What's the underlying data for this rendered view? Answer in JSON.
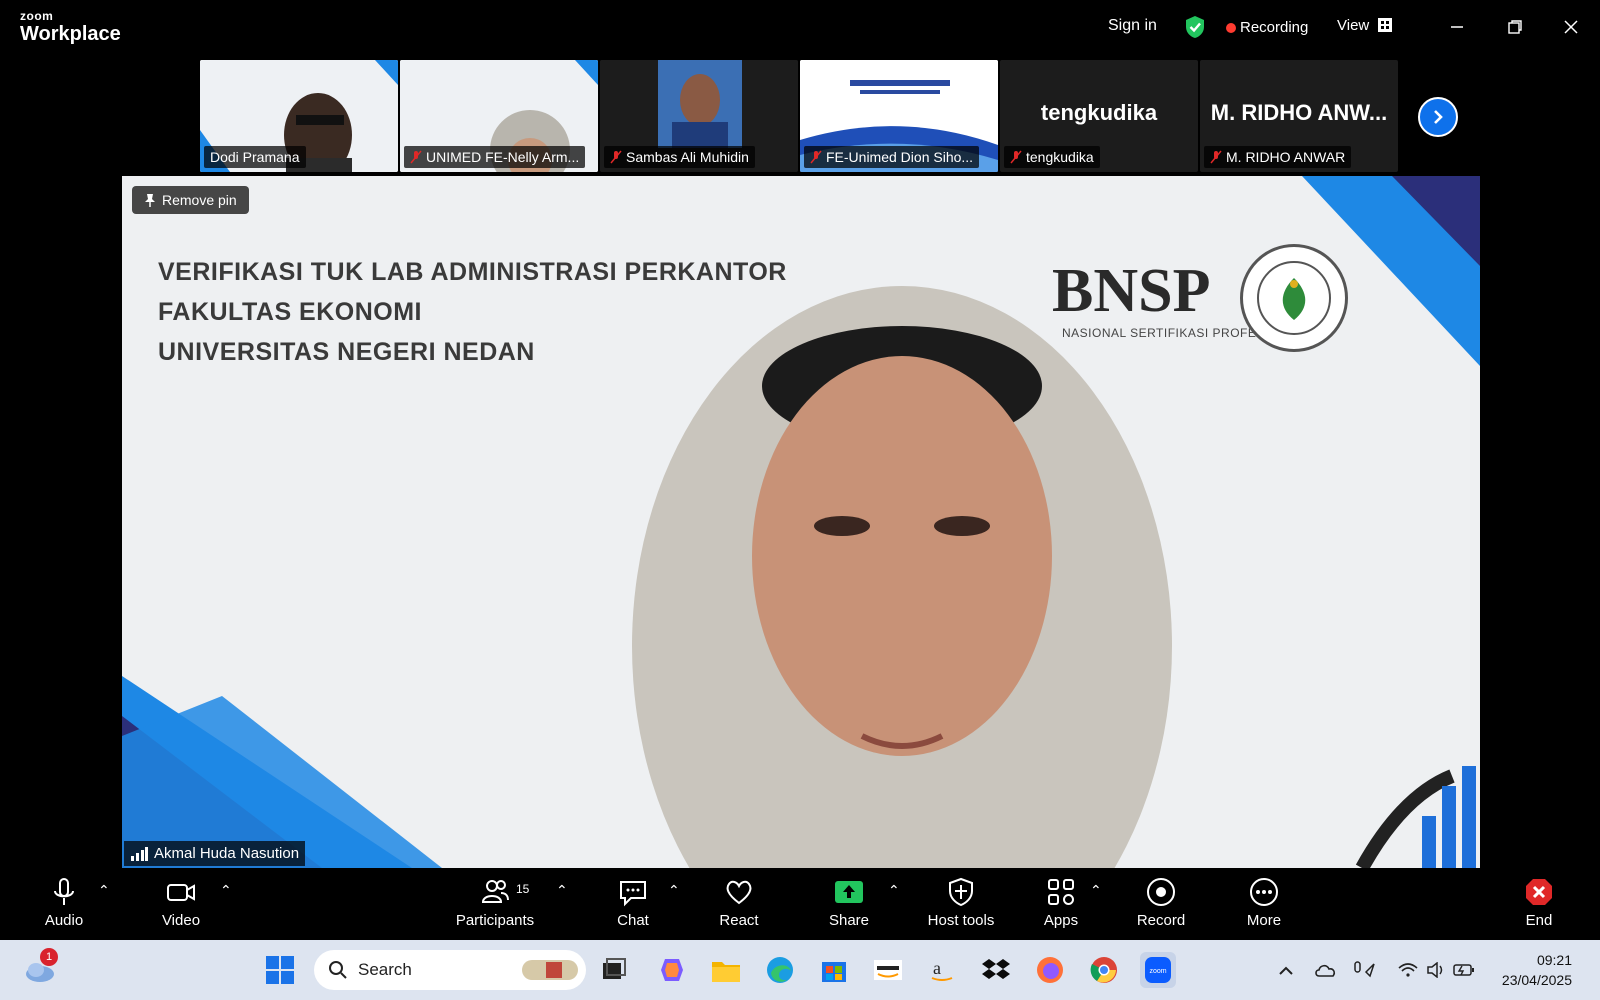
{
  "app": {
    "brand_small": "zoom",
    "brand_large": "Workplace"
  },
  "titlebar": {
    "sign_in": "Sign in",
    "recording": "Recording",
    "view": "View"
  },
  "thumbnails": [
    {
      "name": "Dodi Pramana",
      "muted": false,
      "kind": "video"
    },
    {
      "name": "UNIMED FE-Nelly Arm...",
      "muted": true,
      "kind": "video"
    },
    {
      "name": "Sambas Ali Muhidin",
      "muted": true,
      "kind": "video"
    },
    {
      "name": "FE-Unimed Dion Siho...",
      "muted": true,
      "kind": "video"
    },
    {
      "name": "tengkudika",
      "muted": true,
      "kind": "name-only",
      "display": "tengkudika"
    },
    {
      "name": "M. RIDHO ANWAR",
      "muted": true,
      "kind": "name-only",
      "display": "M. RIDHO ANW..."
    }
  ],
  "main_video": {
    "remove_pin": "Remove pin",
    "speaker": "Akmal Huda Nasution",
    "slide_lines": [
      "VERIFIKASI TUK LAB ADMINISTRASI PERKANTOR",
      "FAKULTAS EKONOMI",
      "UNIVERSITAS NEGERI NEDAN"
    ],
    "logo_text": "BNSP",
    "logo_sub": "NASIONAL SERTIFIKASI PROFESI"
  },
  "toolbar": {
    "audio": "Audio",
    "video": "Video",
    "participants": "Participants",
    "participants_count": "15",
    "chat": "Chat",
    "react": "React",
    "share": "Share",
    "host_tools": "Host tools",
    "apps": "Apps",
    "record": "Record",
    "more": "More",
    "end": "End"
  },
  "taskbar": {
    "search_placeholder": "Search",
    "weather_badge": "1",
    "time": "09:21",
    "date": "23/04/2025"
  },
  "colors": {
    "accent": "#0e71eb",
    "share_green": "#22c55e",
    "recording_red": "#ff3b30",
    "end_red": "#e02828"
  }
}
